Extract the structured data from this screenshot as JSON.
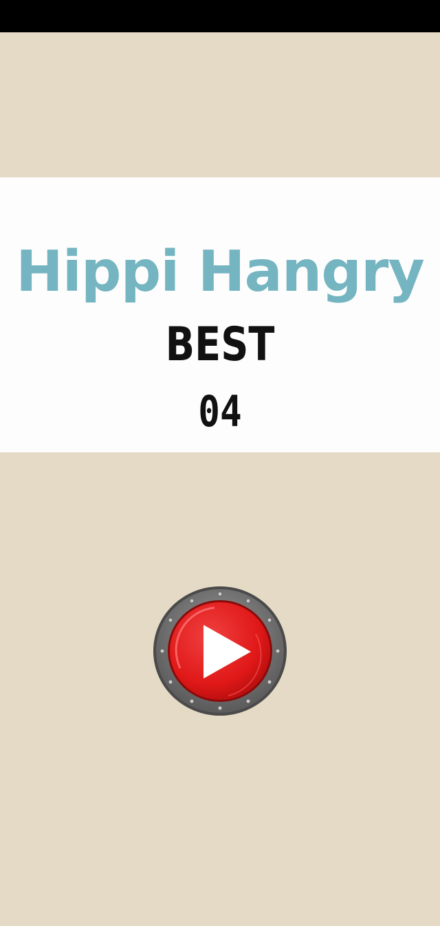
{
  "game": {
    "title": "Hippi Hangry",
    "best_label": "BEST",
    "best_score": "04"
  },
  "play_button": {
    "icon": "play-icon"
  },
  "colors": {
    "background": "#e4dac5",
    "panel": "#fdfdfd",
    "title": "#74b5c1",
    "text": "#111111",
    "button_red": "#e41c1c",
    "button_rim": "#707070",
    "status_bar": "#000000"
  }
}
